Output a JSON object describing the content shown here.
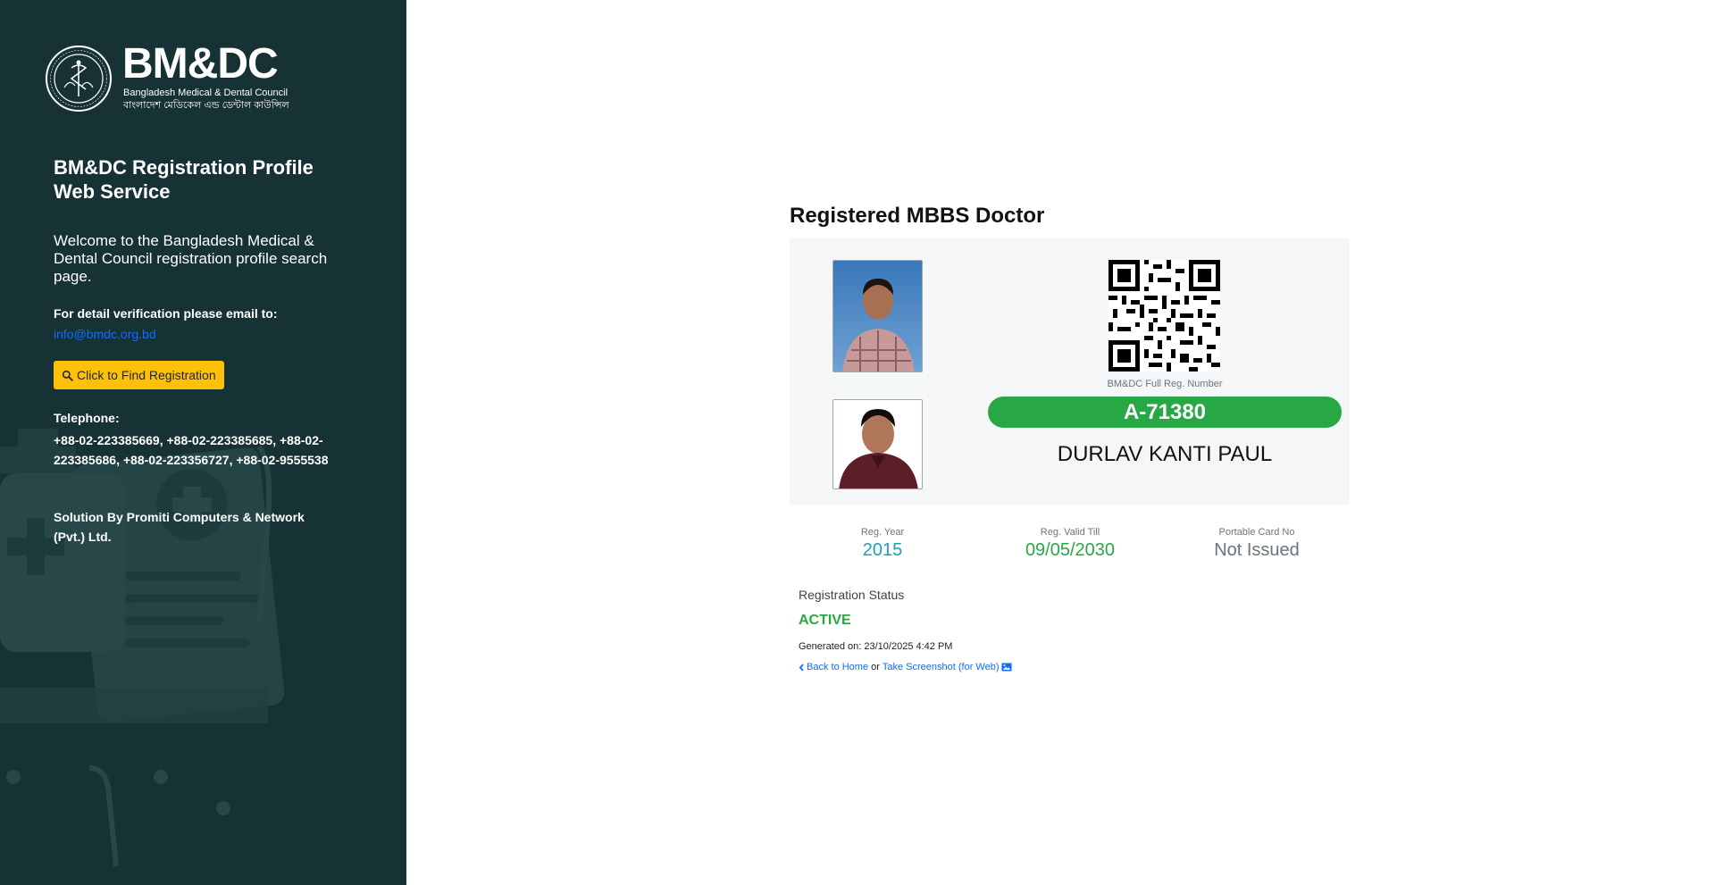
{
  "sidebar": {
    "logo": {
      "wordmark": "BM&DC",
      "subtitle_en": "Bangladesh Medical & Dental Council",
      "subtitle_bn": "বাংলাদেশ মেডিকেল এন্ড ডেন্টাল কাউন্সিল"
    },
    "title": "BM&DC Registration Profile Web Service",
    "welcome": "Welcome to the Bangladesh Medical & Dental Council registration profile search page.",
    "verify_label": "For detail verification please email to:",
    "email": "info@bmdc.org.bd",
    "find_button_label": "Click to Find Registration",
    "telephone_label": "Telephone:",
    "telephone": "+88-02-223385669, +88-02-223385685, +88-02-223385686, +88-02-223356727, +88-02-9555538",
    "solution": "Solution By Promiti Computers & Network (Pvt.) Ltd."
  },
  "main": {
    "title": "Registered MBBS Doctor",
    "qr_label": "BM&DC Full Reg. Number",
    "reg_number": "A-71380",
    "doctor_name": "DURLAV KANTI PAUL",
    "stats": {
      "reg_year_label": "Reg. Year",
      "reg_year": "2015",
      "valid_till_label": "Reg. Valid Till",
      "valid_till": "09/05/2030",
      "card_label": "Portable Card No",
      "card_value": "Not Issued"
    },
    "status_label": "Registration Status",
    "status_value": "ACTIVE",
    "generated": "Generated on: 23/10/2025 4:42 PM",
    "back_link": "Back to Home",
    "or_text": "or",
    "screenshot_link": "Take Screenshot (for Web)"
  },
  "colors": {
    "sidebar_bg": "#173234",
    "accent_yellow": "#ffc107",
    "success_green": "#28a745",
    "info_teal": "#17a2b8",
    "link_blue": "#0d6efd"
  }
}
